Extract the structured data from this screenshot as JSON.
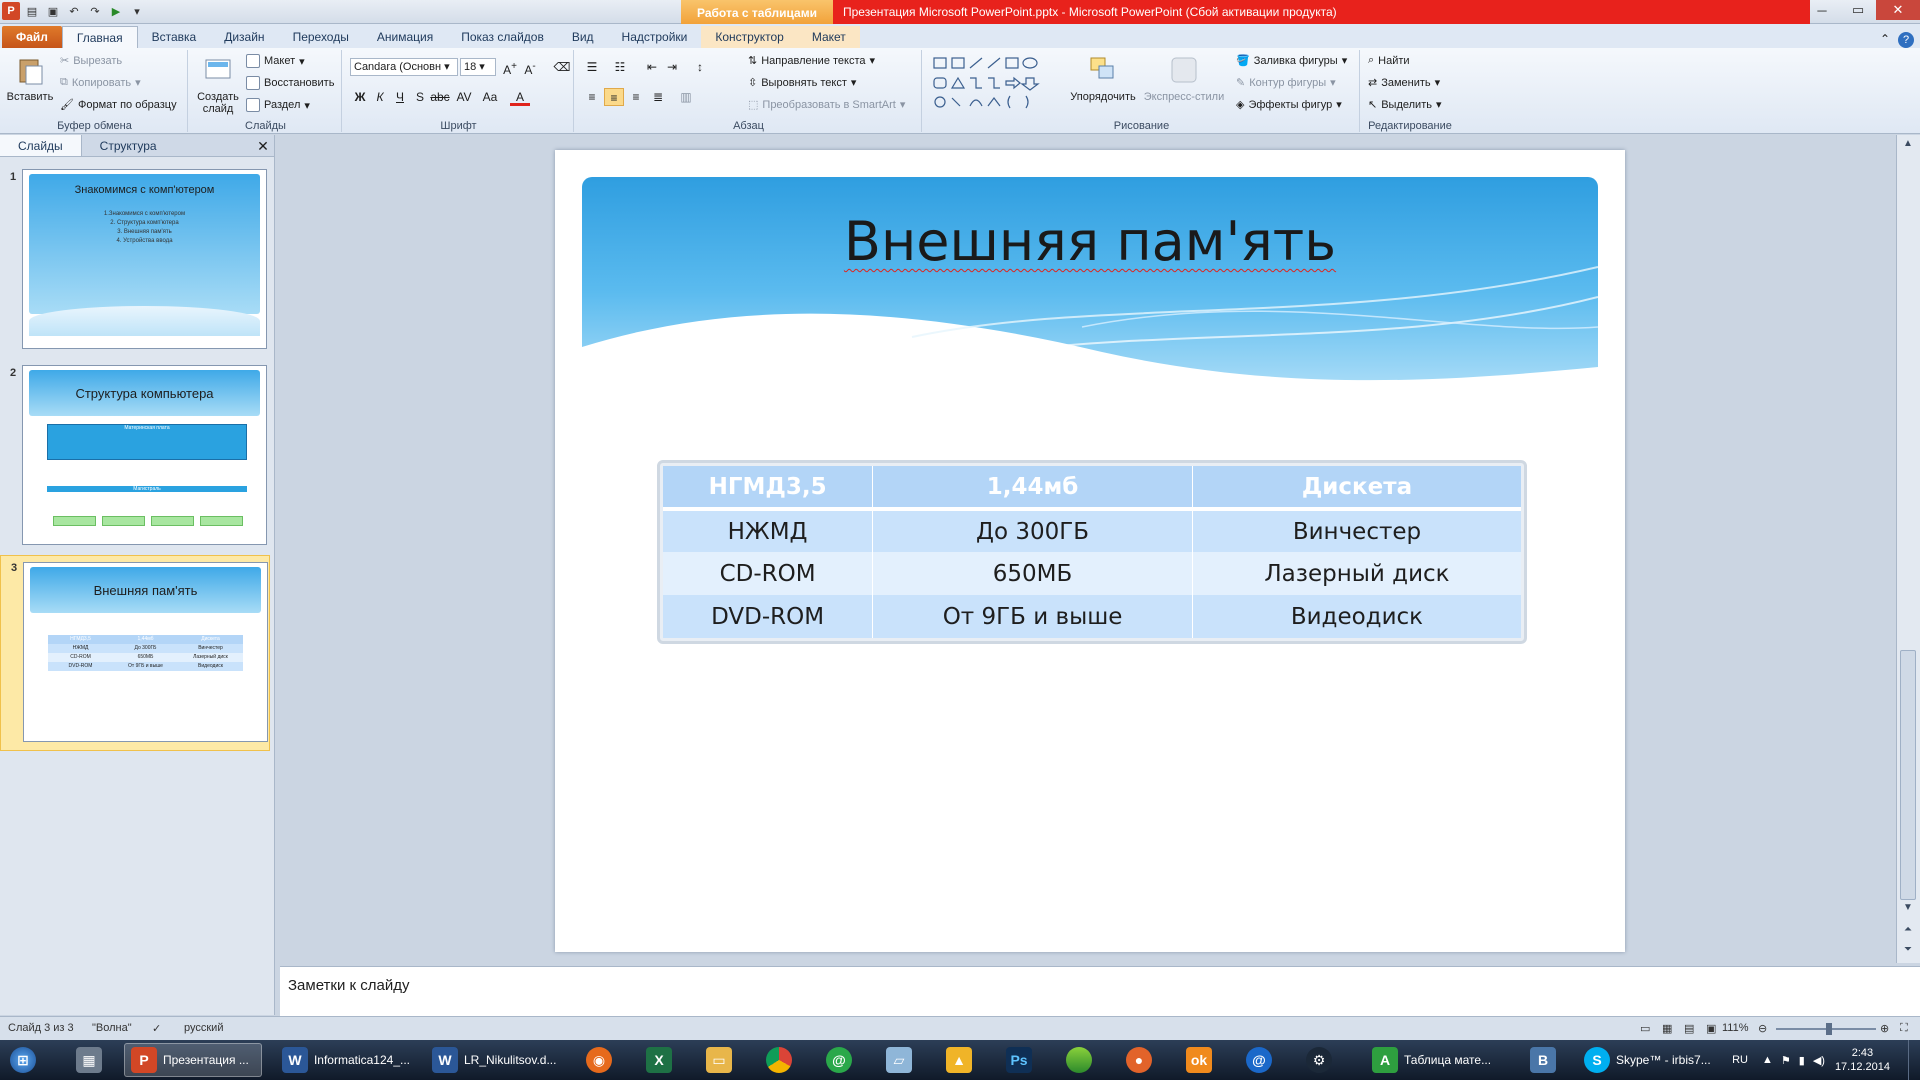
{
  "titlebar": {
    "context_tab": "Работа с таблицами",
    "title": "Презентация Microsoft PowerPoint.pptx - Microsoft PowerPoint (Сбой активации продукта)"
  },
  "tabs": [
    "Файл",
    "Главная",
    "Вставка",
    "Дизайн",
    "Переходы",
    "Анимация",
    "Показ слайдов",
    "Вид",
    "Надстройки",
    "Конструктор",
    "Макет"
  ],
  "ribbon": {
    "clipboard": {
      "paste": "Вставить",
      "cut": "Вырезать",
      "copy": "Копировать",
      "format_painter": "Формат по образцу",
      "label": "Буфер обмена"
    },
    "slides": {
      "new_slide": "Создать слайд",
      "layout": "Макет",
      "reset": "Восстановить",
      "section": "Раздел",
      "label": "Слайды"
    },
    "font": {
      "name": "Candara (Основн",
      "size": "18",
      "label": "Шрифт"
    },
    "paragraph": {
      "text_direction": "Направление текста",
      "align_text": "Выровнять текст",
      "smartart": "Преобразовать в SmartArt",
      "label": "Абзац"
    },
    "drawing": {
      "arrange": "Упорядочить",
      "quick_styles": "Экспресс-стили",
      "fill": "Заливка фигуры",
      "outline": "Контур фигуры",
      "effects": "Эффекты фигур",
      "label": "Рисование"
    },
    "editing": {
      "find": "Найти",
      "replace": "Заменить",
      "select": "Выделить",
      "label": "Редактирование"
    }
  },
  "left_panel": {
    "tab_slides": "Слайды",
    "tab_outline": "Структура",
    "thumbs": [
      {
        "num": "1",
        "title": "Знакомимся с комп'ютером",
        "lines": [
          "1.Знакомимся с комп'ютером",
          "2. Структура комп'ютера",
          "3. Внешняя пам'ять",
          "4. Устройства ввода"
        ]
      },
      {
        "num": "2",
        "title": "Структура компьютера",
        "board": "Материнская плата",
        "bus": "Магистраль"
      },
      {
        "num": "3",
        "title": "Внешняя пам'ять"
      }
    ]
  },
  "slide": {
    "title": "Внешняя пам'ять",
    "table": {
      "header": [
        "НГМД3,5",
        "1,44мб",
        "Дискета"
      ],
      "rows": [
        [
          "НЖМД",
          "До 300ГБ",
          "Винчестер"
        ],
        [
          "CD-ROM",
          "650МБ",
          "Лазерный диск"
        ],
        [
          "DVD-ROM",
          "От 9ГБ и выше",
          "Видеодиск"
        ]
      ]
    }
  },
  "notes": "Заметки к слайду",
  "status": {
    "slide_of": "Слайд 3 из 3",
    "theme": "\"Волна\"",
    "lang": "русский",
    "zoom": "111%"
  },
  "taskbar": {
    "items": [
      "Презентация ...",
      "Informatica124_...",
      "LR_Nikulitsov.d...",
      "Таблица мате...",
      "Skype™ - irbis7..."
    ],
    "lang": "RU",
    "time": "2:43",
    "date": "17.12.2014"
  }
}
